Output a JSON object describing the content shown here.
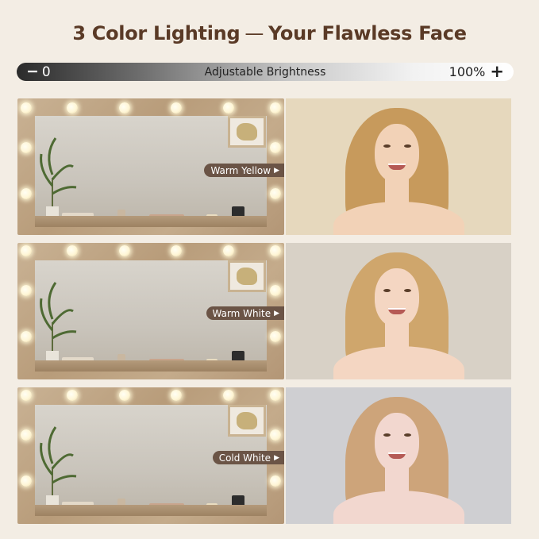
{
  "headline": {
    "left": "3 Color Lighting",
    "dash": "—",
    "right": "Your Flawless Face"
  },
  "brightness": {
    "min_symbol": "−",
    "min_value": "0",
    "label": "Adjustable Brightness",
    "max_value": "100%",
    "max_symbol": "+"
  },
  "modes": [
    {
      "label": "Warm Yellow",
      "arrow": "▶",
      "bg": "#e6d8bd",
      "skin": "#f2d2b7",
      "hair": "#c79a5c"
    },
    {
      "label": "Warm White",
      "arrow": "▶",
      "bg": "#d8d1c6",
      "skin": "#f4d6c2",
      "hair": "#cfa66c"
    },
    {
      "label": "Cold White",
      "arrow": "▶",
      "bg": "#cfcfd2",
      "skin": "#f2d7cf",
      "hair": "#cda47a"
    }
  ]
}
